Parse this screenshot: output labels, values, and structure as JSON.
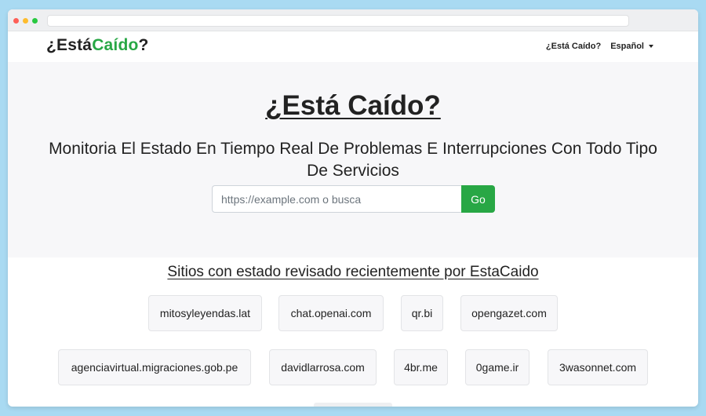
{
  "brand": {
    "prefix": "¿Está",
    "accent": "Caído",
    "suffix": "?",
    "accent_color": "#28a745"
  },
  "nav": {
    "home_label": "¿Está Caído?",
    "language_label": "Español"
  },
  "hero": {
    "title": "¿Está Caído?",
    "subtitle": "Monitoria El Estado En Tiempo Real De Problemas E Interrupciones Con Todo Tipo De Servicios",
    "search_placeholder": "https://example.com o busca",
    "search_value": "",
    "go_label": "Go"
  },
  "recent": {
    "title": "Sitios con estado revisado recientemente por EstaCaido",
    "sites": [
      "mitosyleyendas.lat",
      "chat.openai.com",
      "qr.bi",
      "opengazet.com",
      "agenciavirtual.migraciones.gob.pe",
      "davidlarrosa.com",
      "4br.me",
      "0game.ir",
      "3wasonnet.com"
    ]
  },
  "icons": [
    "chevron-down-icon"
  ],
  "colors": {
    "background": "#a9daf2",
    "hero_bg": "#f7f7f9",
    "go_button": "#28a745"
  }
}
